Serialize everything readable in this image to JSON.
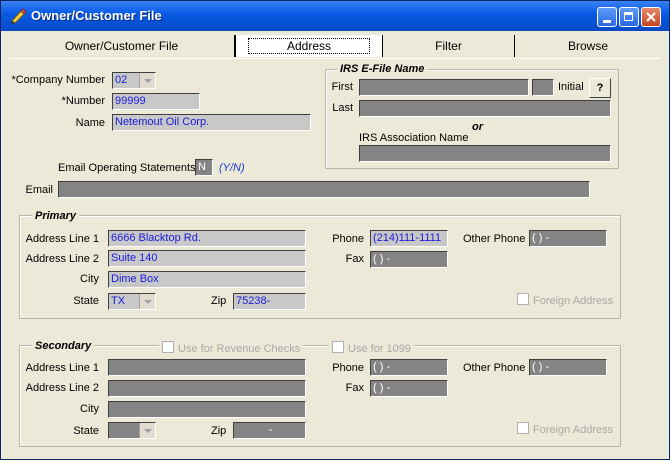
{
  "window": {
    "title": "Owner/Customer File"
  },
  "tabs": [
    {
      "label": "Owner/Customer File"
    },
    {
      "label": "Address"
    },
    {
      "label": "Filter"
    },
    {
      "label": "Browse"
    }
  ],
  "company": {
    "company_number_label": "*Company Number",
    "company_number_value": "02",
    "number_label": "*Number",
    "number_value": "99999",
    "name_label": "Name",
    "name_value": "Netemout Oil Corp."
  },
  "irs": {
    "title": "IRS E-File Name",
    "first_label": "First",
    "first_value": "",
    "initial_label": "Initial",
    "initial_value": "",
    "help_label": "?",
    "last_label": "Last",
    "last_value": "",
    "or_text": "or",
    "assoc_label": "IRS Association Name",
    "assoc_value": ""
  },
  "email": {
    "operating_label": "Email Operating Statements",
    "operating_value": "N",
    "operating_hint": "(Y/N)",
    "email_label": "Email",
    "email_value": ""
  },
  "primary": {
    "title": "Primary",
    "addr1_label": "Address Line 1",
    "addr1_value": "6666 Blacktop Rd.",
    "addr2_label": "Address Line 2",
    "addr2_value": "Suite 140",
    "city_label": "City",
    "city_value": "Dime Box",
    "state_label": "State",
    "state_value": "TX",
    "zip_label": "Zip",
    "zip_value": "75238-",
    "phone_label": "Phone",
    "phone_value": "(214)111-1111",
    "fax_label": "Fax",
    "fax_value": "(   )    -",
    "other_phone_label": "Other Phone",
    "other_phone_value": "(   )    -",
    "foreign_label": "Foreign Address"
  },
  "secondary": {
    "title": "Secondary",
    "revenue_checks_label": "Use for Revenue Checks",
    "use_1099_label": "Use for 1099",
    "addr1_label": "Address Line 1",
    "addr1_value": "",
    "addr2_label": "Address Line 2",
    "addr2_value": "",
    "city_label": "City",
    "city_value": "",
    "state_label": "State",
    "state_value": "",
    "zip_label": "Zip",
    "zip_value": "-",
    "phone_label": "Phone",
    "phone_value": "(   )    -",
    "fax_label": "Fax",
    "fax_value": "(   )    -",
    "other_phone_label": "Other Phone",
    "other_phone_value": "(   )    -",
    "foreign_label": "Foreign Address"
  }
}
